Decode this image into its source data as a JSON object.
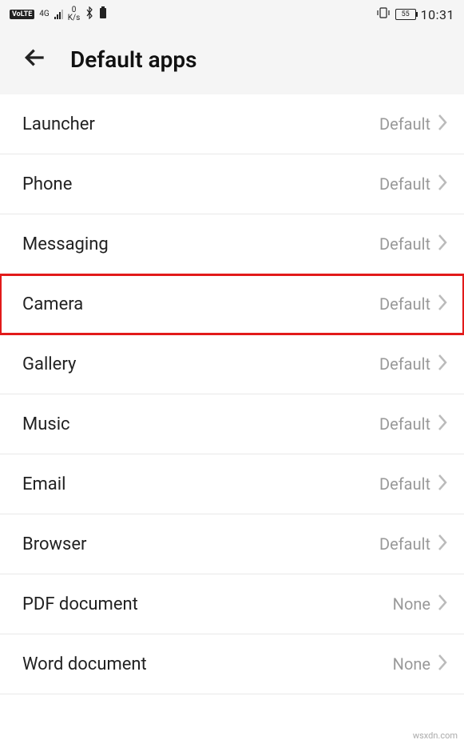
{
  "status": {
    "volte": "VoLTE",
    "net_gen": "4G",
    "speed_top": "0",
    "speed_unit": "K/s",
    "battery_level": "55",
    "clock": "10:31"
  },
  "header": {
    "title": "Default apps"
  },
  "items": [
    {
      "label": "Launcher",
      "value": "Default",
      "highlighted": false
    },
    {
      "label": "Phone",
      "value": "Default",
      "highlighted": false
    },
    {
      "label": "Messaging",
      "value": "Default",
      "highlighted": false
    },
    {
      "label": "Camera",
      "value": "Default",
      "highlighted": true
    },
    {
      "label": "Gallery",
      "value": "Default",
      "highlighted": false
    },
    {
      "label": "Music",
      "value": "Default",
      "highlighted": false
    },
    {
      "label": "Email",
      "value": "Default",
      "highlighted": false
    },
    {
      "label": "Browser",
      "value": "Default",
      "highlighted": false
    },
    {
      "label": "PDF document",
      "value": "None",
      "highlighted": false
    },
    {
      "label": "Word document",
      "value": "None",
      "highlighted": false
    }
  ],
  "watermark": "wsxdn.com"
}
